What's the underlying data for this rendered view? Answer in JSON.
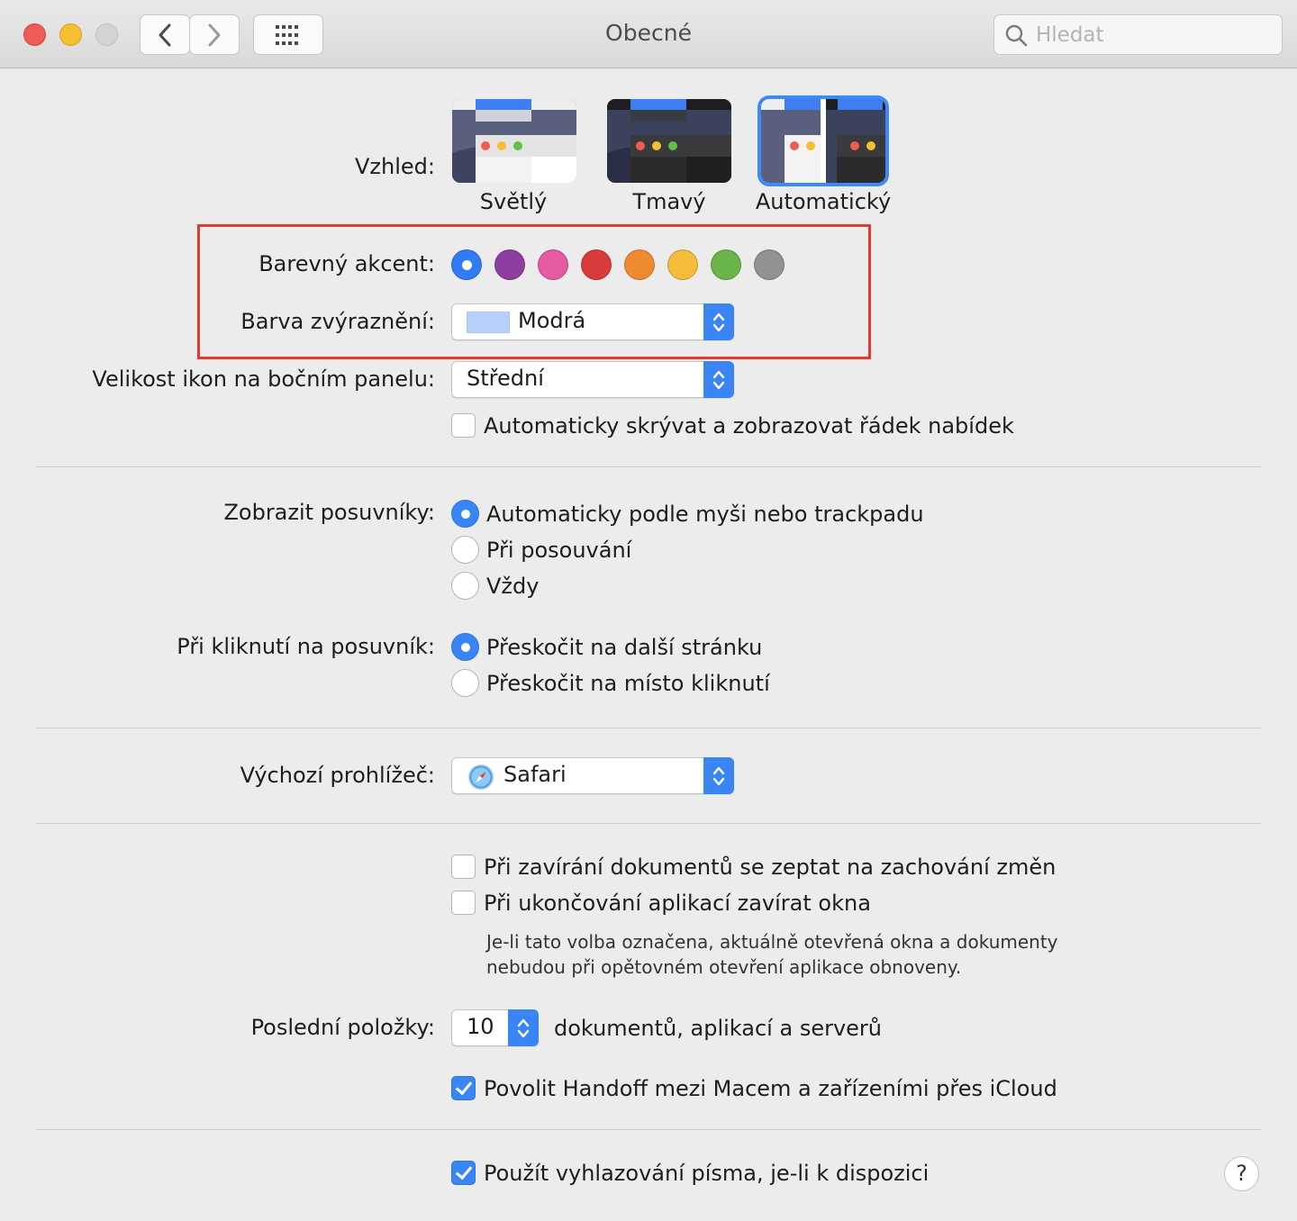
{
  "window": {
    "title": "Obecné"
  },
  "search": {
    "placeholder": "Hledat"
  },
  "appearance": {
    "label": "Vzhled:",
    "options": [
      "Světlý",
      "Tmavý",
      "Automatický"
    ],
    "selected": "Automatický"
  },
  "accent": {
    "label": "Barevný akcent:",
    "colors": [
      "#2f7cf6",
      "#8e3ea0",
      "#e55aa2",
      "#d93a3c",
      "#ee8a32",
      "#f5bc3c",
      "#69b54a",
      "#929292"
    ],
    "selected_index": 0
  },
  "highlight": {
    "label": "Barva zvýraznění:",
    "value": "Modrá",
    "swatch": "#b4d1fb"
  },
  "sidebar_icons": {
    "label": "Velikost ikon na bočním panelu:",
    "value": "Střední"
  },
  "menubar": {
    "label": "Automaticky skrývat a zobrazovat řádek nabídek",
    "checked": false
  },
  "scrollbars": {
    "label": "Zobrazit posuvníky:",
    "options": [
      "Automaticky podle myši nebo trackpadu",
      "Při posouvání",
      "Vždy"
    ],
    "selected_index": 0
  },
  "scroll_click": {
    "label": "Při kliknutí na posuvník:",
    "options": [
      "Přeskočit na další stránku",
      "Přeskočit na místo kliknutí"
    ],
    "selected_index": 0
  },
  "browser": {
    "label": "Výchozí prohlížeč:",
    "value": "Safari"
  },
  "close_docs": {
    "label": "Při zavírání dokumentů se zeptat na zachování změn",
    "checked": false
  },
  "quit_apps": {
    "label": "Při ukončování aplikací zavírat okna",
    "checked": false,
    "note_line1": "Je-li tato volba označena, aktuálně otevřená okna a dokumenty",
    "note_line2": "nebudou při opětovném otevření aplikace obnoveny."
  },
  "recent": {
    "label": "Poslední položky:",
    "value": "10",
    "suffix": "dokumentů, aplikací a serverů"
  },
  "handoff": {
    "label": "Povolit Handoff mezi Macem a zařízeními přes iCloud",
    "checked": true
  },
  "font_smoothing": {
    "label": "Použít vyhlazování písma, je-li k dispozici",
    "checked": true
  },
  "help": {
    "label": "?"
  }
}
